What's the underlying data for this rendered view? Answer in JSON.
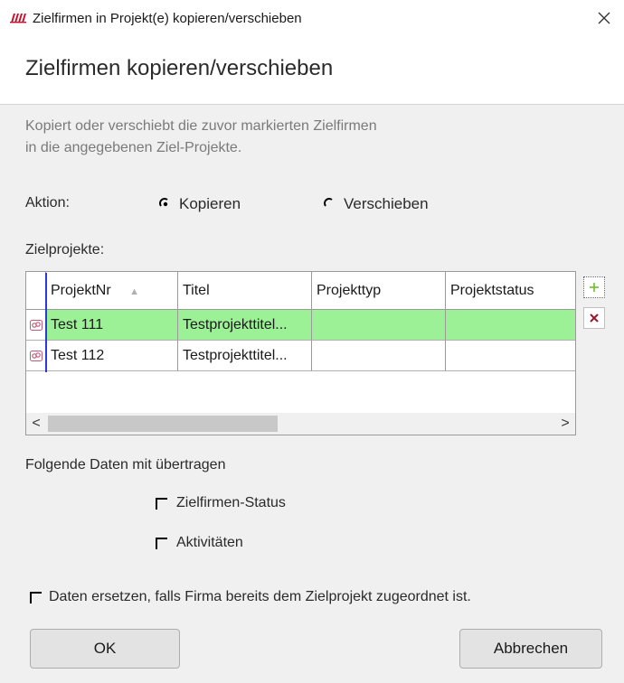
{
  "window": {
    "title": "Zielfirmen in Projekt(e) kopieren/verschieben"
  },
  "header": {
    "heading": "Zielfirmen kopieren/verschieben"
  },
  "description": {
    "line1": "Kopiert oder verschiebt die zuvor markierten Zielfirmen",
    "line2": "in die angegebenen Ziel-Projekte."
  },
  "action": {
    "label": "Aktion:",
    "options": [
      {
        "label": "Kopieren",
        "selected": true
      },
      {
        "label": "Verschieben",
        "selected": false
      }
    ]
  },
  "projects": {
    "label": "Zielprojekte:",
    "columns": [
      "ProjektNr",
      "Titel",
      "Projekttyp",
      "Projektstatus"
    ],
    "sort_indicator": "▲",
    "rows": [
      {
        "nr": "Test 111",
        "titel": "Testprojekttitel...",
        "typ": "",
        "status": "",
        "selected": true
      },
      {
        "nr": "Test 112",
        "titel": "Testprojekttitel...",
        "typ": "",
        "status": "",
        "selected": false
      }
    ],
    "scroll_left": "<",
    "scroll_right": ">"
  },
  "transfer": {
    "label": "Folgende Daten mit übertragen",
    "options": [
      {
        "label": "Zielfirmen-Status",
        "checked": false
      },
      {
        "label": "Aktivitäten",
        "checked": false
      }
    ]
  },
  "replace": {
    "label": "Daten ersetzen, falls Firma bereits dem Zielprojekt zugeordnet ist.",
    "checked": false
  },
  "buttons": {
    "ok": "OK",
    "cancel": "Abbrechen"
  },
  "colors": {
    "selected_row": "#9cf096",
    "add_icon": "#6cbf2a",
    "delete_icon": "#9b1b30",
    "indicator_line": "#2a3ad8"
  }
}
